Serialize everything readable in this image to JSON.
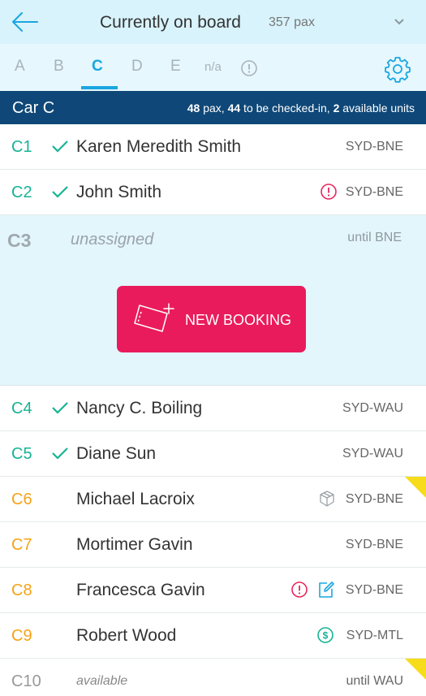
{
  "header": {
    "title": "Currently on board",
    "pax": "357 pax"
  },
  "tabs": [
    {
      "label": "A"
    },
    {
      "label": "B"
    },
    {
      "label": "C"
    },
    {
      "label": "D"
    },
    {
      "label": "E"
    },
    {
      "label": "n/a"
    }
  ],
  "car": {
    "title": "Car C",
    "pax_count": "48",
    "pax_text": " pax, ",
    "checkin_count": "44",
    "checkin_text": " to be checked-in, ",
    "units_count": "2",
    "units_text": " available units"
  },
  "rows": [
    {
      "seat": "C1",
      "name": "Karen Meredith Smith",
      "route": "SYD-BNE"
    },
    {
      "seat": "C2",
      "name": "John Smith",
      "route": "SYD-BNE"
    },
    {
      "seat": "C3",
      "name": "unassigned",
      "route": "until BNE"
    },
    {
      "seat": "C4",
      "name": "Nancy C. Boiling",
      "route": "SYD-WAU"
    },
    {
      "seat": "C5",
      "name": "Diane Sun",
      "route": "SYD-WAU"
    },
    {
      "seat": "C6",
      "name": "Michael Lacroix",
      "route": "SYD-BNE"
    },
    {
      "seat": "C7",
      "name": "Mortimer Gavin",
      "route": "SYD-BNE"
    },
    {
      "seat": "C8",
      "name": "Francesca Gavin",
      "route": "SYD-BNE"
    },
    {
      "seat": "C9",
      "name": "Robert Wood",
      "route": "SYD-MTL"
    },
    {
      "seat": "C10",
      "name": "available",
      "route": "until WAU"
    }
  ],
  "new_booking": {
    "label": "NEW BOOKING"
  },
  "icons": {
    "back": "arrow-left-icon",
    "dropdown": "chevron-down-icon",
    "settings": "gear-icon",
    "alert": "alert-circle-icon",
    "check": "checkmark-icon",
    "package": "package-icon",
    "edit": "edit-icon",
    "payment": "dollar-circle-icon",
    "ticket": "ticket-plus-icon"
  },
  "colors": {
    "header_bg": "#d8f3fb",
    "accent_blue": "#1aa6e0",
    "car_bar": "#0f4878",
    "checked_in": "#16b394",
    "pending": "#f4a416",
    "alert": "#e8285d",
    "booking_button": "#ea1b5c",
    "corner_flag": "#f6dc1a",
    "payment": "#16b394"
  }
}
